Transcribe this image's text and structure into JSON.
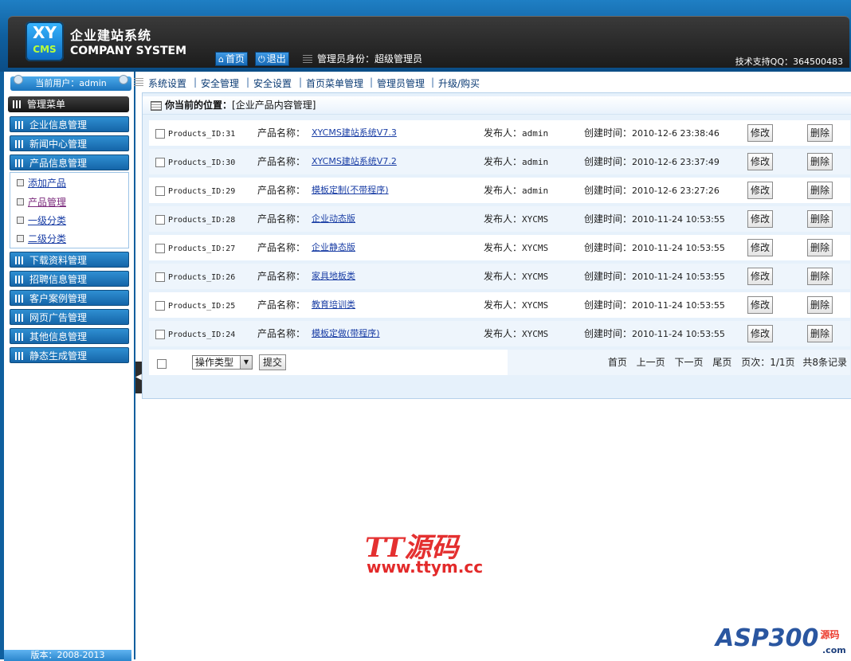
{
  "header": {
    "brand_cn": "企业建站系统",
    "brand_en": "COMPANY SYSTEM",
    "logo_top": "XY",
    "logo_bottom": "CMS",
    "home_label": "首页",
    "logout_label": "退出",
    "admin_role": "管理员身份：超级管理员",
    "tech_support": "技术支持QQ：364500483"
  },
  "sidebar": {
    "current_user": "当前用户：admin",
    "manage_menu": "管理菜单",
    "groups": [
      {
        "label": "企业信息管理"
      },
      {
        "label": "新闻中心管理"
      },
      {
        "label": "产品信息管理"
      },
      {
        "label": "下载资料管理"
      },
      {
        "label": "招聘信息管理"
      },
      {
        "label": "客户案例管理"
      },
      {
        "label": "网页广告管理"
      },
      {
        "label": "其他信息管理"
      },
      {
        "label": "静态生成管理"
      }
    ],
    "sub_items": [
      {
        "label": "添加产品"
      },
      {
        "label": "产品管理"
      },
      {
        "label": "一级分类"
      },
      {
        "label": "二级分类"
      }
    ],
    "version": "版本：2008-2013"
  },
  "topnav": {
    "items": [
      {
        "label": "系统设置"
      },
      {
        "label": "安全管理"
      },
      {
        "label": "安全设置"
      },
      {
        "label": "首页菜单管理"
      },
      {
        "label": "管理员管理"
      },
      {
        "label": "升级/购买"
      }
    ]
  },
  "content": {
    "position_label": "你当前的位置：",
    "position_value": "[企业产品内容管理]",
    "name_label": "产品名称：",
    "publisher_label": "发布人：",
    "time_label": "创建时间：",
    "edit_label": "修改",
    "delete_label": "删除",
    "rows": [
      {
        "id": "Products_ID:31",
        "name": "XYCMS建站系统V7.3",
        "publisher": "admin",
        "time": "2010-12-6 23:38:46"
      },
      {
        "id": "Products_ID:30",
        "name": "XYCMS建站系统V7.2",
        "publisher": "admin",
        "time": "2010-12-6 23:37:49"
      },
      {
        "id": "Products_ID:29",
        "name": "模板定制(不带程序)",
        "publisher": "admin",
        "time": "2010-12-6 23:27:26"
      },
      {
        "id": "Products_ID:28",
        "name": "企业动态版",
        "publisher": "XYCMS",
        "time": "2010-11-24 10:53:55"
      },
      {
        "id": "Products_ID:27",
        "name": "企业静态版",
        "publisher": "XYCMS",
        "time": "2010-11-24 10:53:55"
      },
      {
        "id": "Products_ID:26",
        "name": "家具地板类",
        "publisher": "XYCMS",
        "time": "2010-11-24 10:53:55"
      },
      {
        "id": "Products_ID:25",
        "name": "教育培训类",
        "publisher": "XYCMS",
        "time": "2010-11-24 10:53:55"
      },
      {
        "id": "Products_ID:24",
        "name": "模板定做(带程序)",
        "publisher": "XYCMS",
        "time": "2010-11-24 10:53:55"
      }
    ],
    "action_select": "操作类型",
    "submit_label": "提交",
    "pager": {
      "first": "首页",
      "prev": "上一页",
      "next": "下一页",
      "last": "尾页",
      "page_info": "页次：1/1页",
      "total": "共8条记录"
    }
  },
  "watermarks": {
    "tt_title": "TT源码",
    "tt_url": "www.ttym.cc",
    "asp_main": "ASP300",
    "asp_suffix": "源码",
    "asp_domain": ".com"
  }
}
